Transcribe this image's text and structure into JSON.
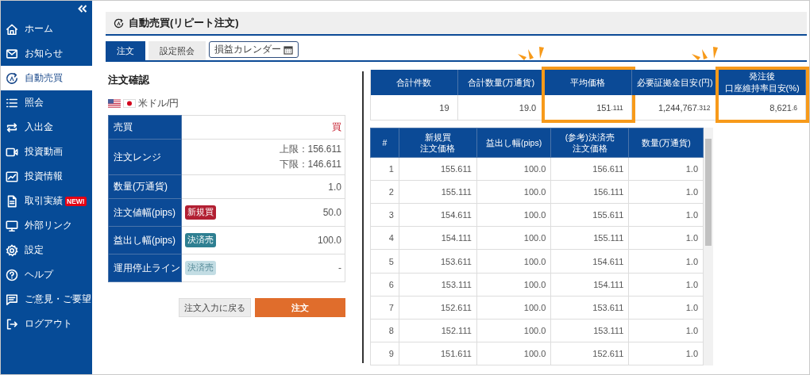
{
  "sidebar": {
    "items": [
      {
        "label": "ホーム",
        "selected": false
      },
      {
        "label": "お知らせ",
        "selected": false
      },
      {
        "label": "自動売買",
        "selected": true
      },
      {
        "label": "照会",
        "selected": false
      },
      {
        "label": "入出金",
        "selected": false
      },
      {
        "label": "投資動画",
        "selected": false
      },
      {
        "label": "投資情報",
        "selected": false
      },
      {
        "label": "取引実績",
        "selected": false,
        "badge": "NEW!"
      },
      {
        "label": "外部リンク",
        "selected": false
      },
      {
        "label": "設定",
        "selected": false
      },
      {
        "label": "ヘルプ",
        "selected": false
      },
      {
        "label": "ご意見・ご要望",
        "selected": false
      },
      {
        "label": "ログアウト",
        "selected": false
      }
    ]
  },
  "page": {
    "title": "自動売買(リピート注文)"
  },
  "tabs": [
    {
      "label": "注文",
      "selected": true
    },
    {
      "label": "設定照会",
      "selected": false
    }
  ],
  "calendar_button": {
    "label": "損益カレンダー"
  },
  "order_confirm": {
    "heading": "注文確認",
    "currency_pair": "米ドル/円",
    "rows": [
      {
        "label": "売買",
        "values": [
          "買"
        ],
        "kind": "buy"
      },
      {
        "label": "注文レンジ",
        "values": [
          "上限：156.611",
          "下限：146.611"
        ],
        "kind": "plain"
      },
      {
        "label": "数量(万通貨)",
        "values": [
          "1.0"
        ],
        "kind": "plain"
      },
      {
        "label": "注文値幅(pips)",
        "values": [
          "50.0"
        ],
        "kind": "plain",
        "badge": {
          "label": "新規買",
          "kind": "buy",
          "disabled": false
        }
      },
      {
        "label": "益出し幅(pips)",
        "values": [
          "100.0"
        ],
        "kind": "plain",
        "badge": {
          "label": "決済売",
          "kind": "sell",
          "disabled": false
        }
      },
      {
        "label": "運用停止ライン",
        "values": [
          "-"
        ],
        "kind": "plain",
        "badge": {
          "label": "決済売",
          "kind": "sell",
          "disabled": true
        }
      }
    ],
    "buttons": [
      {
        "label": "注文入力に戻る",
        "kind": "secondary"
      },
      {
        "label": "注文",
        "kind": "primary"
      }
    ]
  },
  "summary": {
    "columns": [
      {
        "header": "合計件数",
        "value": "19",
        "highlighted": false
      },
      {
        "header": "合計数量(万通貨)",
        "value": "19.0",
        "highlighted": false
      },
      {
        "header": "平均価格",
        "value": "151",
        "fraction": ".111",
        "highlighted": true
      },
      {
        "header": "必要証拠金目安(円)",
        "value": "1,244,767",
        "fraction": ".312",
        "highlighted": false
      },
      {
        "header": "発注後",
        "header_line_2": "口座維持率目安(%)",
        "value": "8,621",
        "fraction": ".6",
        "highlighted": true
      }
    ]
  },
  "orders": {
    "columns": [
      {
        "header": "#"
      },
      {
        "header": "新規買",
        "header_line_2": "注文価格"
      },
      {
        "header": "益出し幅(pips)"
      },
      {
        "header": "(参考)決済売",
        "header_line_2": "注文価格"
      },
      {
        "header": "数量(万通貨)"
      }
    ],
    "rows": [
      [
        "1",
        "155.611",
        "100.0",
        "156.611",
        "1.0"
      ],
      [
        "2",
        "155.111",
        "100.0",
        "156.111",
        "1.0"
      ],
      [
        "3",
        "154.611",
        "100.0",
        "155.611",
        "1.0"
      ],
      [
        "4",
        "154.111",
        "100.0",
        "155.111",
        "1.0"
      ],
      [
        "5",
        "153.611",
        "100.0",
        "154.611",
        "1.0"
      ],
      [
        "6",
        "153.111",
        "100.0",
        "154.111",
        "1.0"
      ],
      [
        "7",
        "152.611",
        "100.0",
        "153.611",
        "1.0"
      ],
      [
        "8",
        "152.111",
        "100.0",
        "153.111",
        "1.0"
      ],
      [
        "9",
        "151.611",
        "100.0",
        "152.611",
        "1.0"
      ]
    ]
  }
}
